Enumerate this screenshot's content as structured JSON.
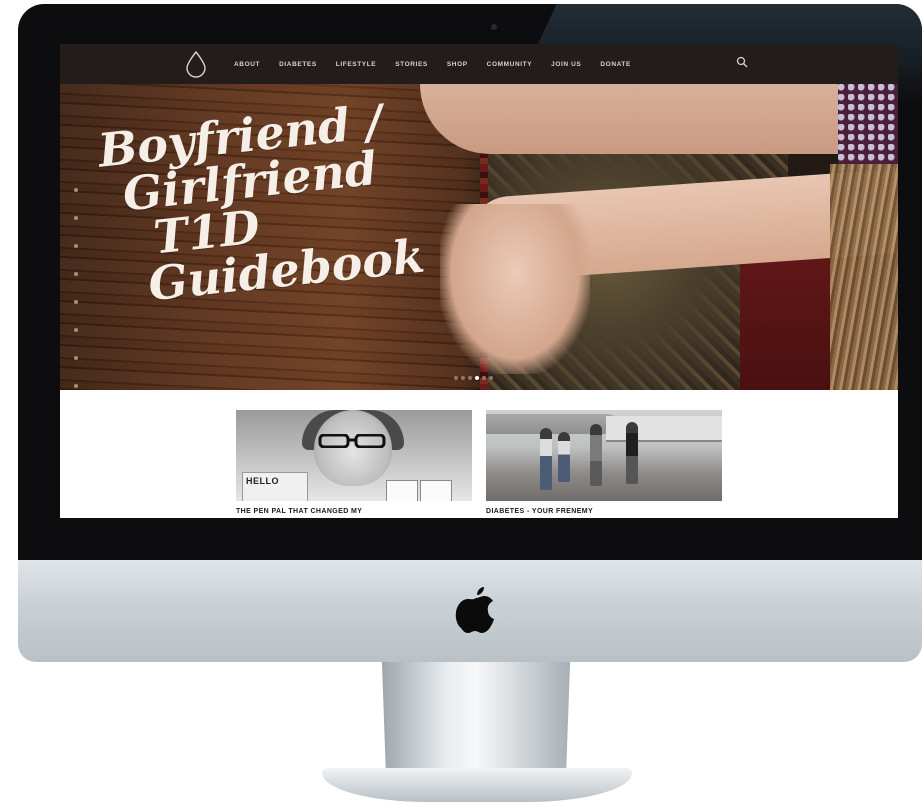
{
  "nav": {
    "items": [
      "ABOUT",
      "DIABETES",
      "LIFESTYLE",
      "STORIES",
      "SHOP",
      "COMMUNITY",
      "JOIN US",
      "DONATE"
    ],
    "logo_icon": "drop-icon",
    "search_icon": "search-icon"
  },
  "hero": {
    "title_lines": [
      "Boyfriend /",
      "Girlfriend",
      "T1D",
      "Guidebook"
    ],
    "slide_count": 6,
    "active_slide": 3
  },
  "cards": [
    {
      "title": "THE PEN PAL THAT CHANGED MY",
      "image_text": "HELLO"
    },
    {
      "title": "DIABETES - YOUR FRENEMY"
    }
  ],
  "colors": {
    "navbar": "#221d1b",
    "nav_text": "#d9d2cc",
    "hero_text": "#f5efe8"
  }
}
